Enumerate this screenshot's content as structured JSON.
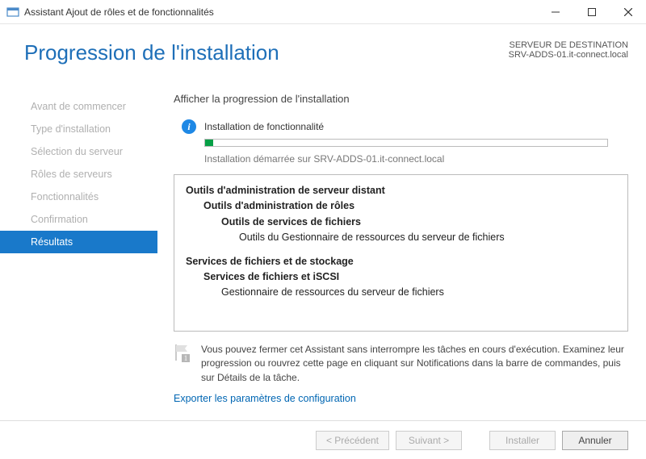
{
  "window": {
    "title": "Assistant Ajout de rôles et de fonctionnalités"
  },
  "header": {
    "page_title": "Progression de l'installation",
    "dest_label": "SERVEUR DE DESTINATION",
    "dest_value": "SRV-ADDS-01.it-connect.local"
  },
  "sidebar": {
    "items": [
      {
        "label": "Avant de commencer",
        "active": false
      },
      {
        "label": "Type d'installation",
        "active": false
      },
      {
        "label": "Sélection du serveur",
        "active": false
      },
      {
        "label": "Rôles de serveurs",
        "active": false
      },
      {
        "label": "Fonctionnalités",
        "active": false
      },
      {
        "label": "Confirmation",
        "active": false
      },
      {
        "label": "Résultats",
        "active": true
      }
    ]
  },
  "main": {
    "subtitle": "Afficher la progression de l'installation",
    "status_label": "Installation de fonctionnalité",
    "progress_percent": 2,
    "status_sub": "Installation démarrée sur SRV-ADDS-01.it-connect.local",
    "details": {
      "g1_title": "Outils d'administration de serveur distant",
      "g1_sub1": "Outils d'administration de rôles",
      "g1_sub2": "Outils de services de fichiers",
      "g1_sub3": "Outils du Gestionnaire de ressources du serveur de fichiers",
      "g2_title": "Services de fichiers et de stockage",
      "g2_sub1": "Services de fichiers et iSCSI",
      "g2_sub2": "Gestionnaire de ressources du serveur de fichiers"
    },
    "note": "Vous pouvez fermer cet Assistant sans interrompre les tâches en cours d'exécution. Examinez leur progression ou rouvrez cette page en cliquant sur Notifications dans la barre de commandes, puis sur Détails de la tâche.",
    "export_link": "Exporter les paramètres de configuration"
  },
  "footer": {
    "prev": "< Précédent",
    "next": "Suivant >",
    "install": "Installer",
    "cancel": "Annuler"
  }
}
